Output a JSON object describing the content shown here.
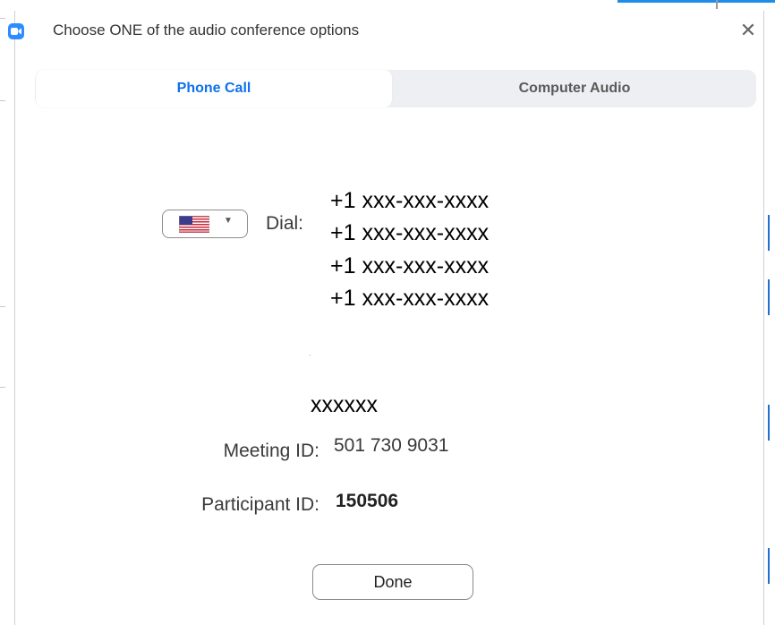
{
  "dialog": {
    "title": "Choose ONE of the audio conference options",
    "close_glyph": "✕"
  },
  "tabs": [
    {
      "label": "Phone Call",
      "active": true
    },
    {
      "label": "Computer Audio",
      "active": false
    }
  ],
  "phone_call": {
    "country": {
      "selected": "United States",
      "icon": "us-flag-icon"
    },
    "dial_label": "Dial:",
    "numbers": [
      "+1 xxx-xxx-xxxx",
      "+1 xxx-xxx-xxxx",
      "+1 xxx-xxx-xxxx",
      "+1 xxx-xxx-xxxx"
    ],
    "code_text": "xxxxxx",
    "meeting_id_label": "Meeting ID:",
    "meeting_id_value": "501 730 9031",
    "participant_id_label": "Participant ID:",
    "participant_id_value": "150506"
  },
  "footer": {
    "done_label": "Done"
  },
  "colors": {
    "accent": "#0e71eb",
    "app_icon": "#2d8cff",
    "tab_bar_bg": "#eeeff2"
  }
}
